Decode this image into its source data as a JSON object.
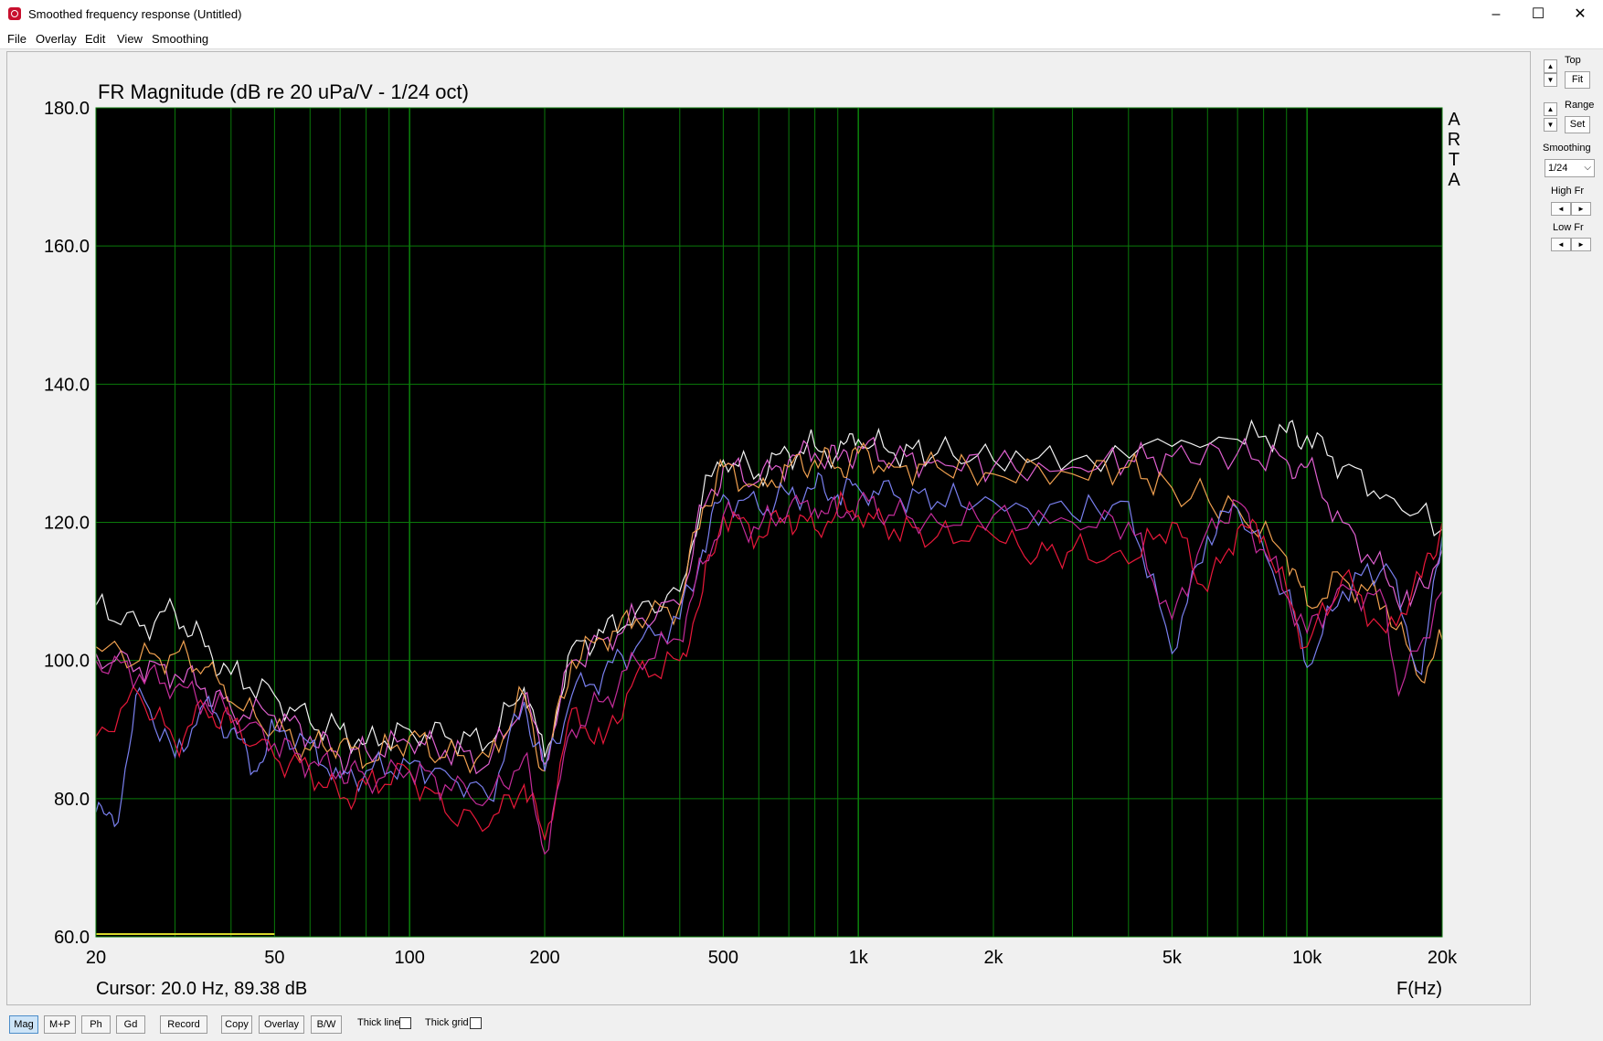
{
  "window": {
    "title": "Smoothed frequency response (Untitled)",
    "controls": [
      "–",
      "☐",
      "✕"
    ]
  },
  "menu": [
    "File",
    "Overlay",
    "Edit",
    "View",
    "Smoothing"
  ],
  "side_panel": {
    "top_label": "Top",
    "fit_label": "Fit",
    "range_label": "Range",
    "set_label": "Set",
    "smoothing_label": "Smoothing",
    "smoothing_value": "1/24",
    "high_fr_label": "High Fr",
    "low_fr_label": "Low Fr",
    "up_arrow": "▲",
    "down_arrow": "▼",
    "left_arrow": "◄",
    "right_arrow": "►",
    "caret": "⌵"
  },
  "bottom_bar": {
    "buttons": [
      "Mag",
      "M+P",
      "Ph",
      "Gd",
      "Record",
      "Copy",
      "Overlay",
      "B/W"
    ],
    "active": "Mag",
    "checkboxes": [
      "Thick line",
      "Thick grid"
    ]
  },
  "colors": {
    "plot_bg": "#000000",
    "grid": "#0a7a0a",
    "frame_bg": "#f0f0f0",
    "cursor": "#d8d82a",
    "series": [
      "#f2f2f2",
      "#e060d0",
      "#f0a050",
      "#7a80f0",
      "#e8183a",
      "#c42c9a"
    ]
  },
  "chart_data": {
    "type": "line",
    "title": "FR Magnitude (dB re 20 uPa/V - 1/24 oct)",
    "watermark": [
      "A",
      "R",
      "T",
      "A"
    ],
    "xlabel": "F(Hz)",
    "x_scale": "log",
    "xlim": [
      20,
      20000
    ],
    "ylim": [
      60,
      180
    ],
    "x_ticks": [
      20,
      50,
      100,
      200,
      500,
      1000,
      2000,
      5000,
      10000,
      20000
    ],
    "x_tick_labels": [
      "20",
      "50",
      "100",
      "200",
      "500",
      "1k",
      "2k",
      "5k",
      "10k",
      "20k"
    ],
    "y_ticks": [
      60,
      80,
      100,
      120,
      140,
      160,
      180
    ],
    "y_tick_labels": [
      "60.0",
      "80.0",
      "100.0",
      "120.0",
      "140.0",
      "160.0",
      "180.0"
    ],
    "grid": true,
    "cursor_text": "Cursor: 20.0 Hz, 89.38 dB",
    "cursor_marker": {
      "x": [
        20,
        50
      ],
      "y": 60.4
    },
    "series": [
      {
        "color": "#f2f2f2",
        "x": [
          20,
          25,
          30,
          35,
          40,
          50,
          60,
          70,
          80,
          100,
          120,
          150,
          180,
          200,
          230,
          270,
          320,
          400,
          450,
          500,
          600,
          700,
          800,
          900,
          1000,
          1200,
          1500,
          2000,
          3000,
          5000,
          7000,
          9000,
          10000,
          12000,
          15000,
          20000
        ],
        "y": [
          108,
          105,
          107,
          102,
          98,
          95,
          91,
          90,
          88,
          90,
          89,
          88,
          96,
          86,
          102,
          104,
          107,
          110,
          124,
          129,
          127,
          130,
          131,
          130,
          132,
          130,
          130,
          129,
          129,
          131,
          132,
          133,
          132.5,
          128,
          124,
          119
        ]
      },
      {
        "color": "#e060d0",
        "x": [
          20,
          25,
          30,
          35,
          40,
          50,
          60,
          70,
          80,
          100,
          120,
          150,
          180,
          200,
          230,
          270,
          320,
          400,
          450,
          500,
          600,
          700,
          800,
          900,
          1000,
          1200,
          1500,
          2000,
          3000,
          4000,
          5000,
          7000,
          9000,
          10000,
          12000,
          15000,
          17000,
          20000
        ],
        "y": [
          101,
          99,
          98,
          96,
          93,
          92,
          89,
          86,
          87,
          88,
          87,
          85,
          95,
          85,
          100,
          103,
          106,
          108,
          122,
          128,
          126,
          129,
          130,
          129,
          131,
          129,
          129,
          128,
          128,
          129,
          129.5,
          130,
          129,
          128,
          120,
          112,
          108,
          116
        ]
      },
      {
        "color": "#f0a050",
        "x": [
          20,
          25,
          30,
          35,
          40,
          50,
          60,
          70,
          80,
          100,
          120,
          150,
          180,
          200,
          230,
          270,
          320,
          400,
          450,
          500,
          600,
          700,
          800,
          900,
          1000,
          1200,
          1500,
          2000,
          3000,
          4000,
          5000,
          7000,
          9000,
          10000,
          12000,
          15000,
          18000,
          20000
        ],
        "y": [
          102,
          100,
          101,
          99,
          94,
          90,
          87,
          88,
          85,
          89,
          86,
          86,
          95,
          84,
          100,
          103,
          106,
          108,
          122,
          128,
          125,
          128,
          129,
          128,
          130,
          128,
          128,
          127,
          127,
          128,
          125,
          122,
          115,
          108,
          112,
          108,
          97,
          103
        ]
      },
      {
        "color": "#7a80f0",
        "x": [
          20,
          22,
          25,
          30,
          35,
          40,
          45,
          50,
          60,
          70,
          80,
          100,
          120,
          150,
          180,
          200,
          230,
          270,
          320,
          400,
          450,
          500,
          600,
          700,
          800,
          900,
          1000,
          1200,
          1500,
          2000,
          3000,
          4000,
          5000,
          6000,
          7000,
          9000,
          10000,
          12000,
          15000,
          18000,
          20000
        ],
        "y": [
          78,
          76,
          96,
          86,
          94,
          90,
          84,
          90,
          88,
          83,
          84,
          85,
          84,
          80,
          94,
          84,
          95,
          98,
          102,
          106,
          116,
          124,
          122,
          124,
          125,
          124,
          125,
          124,
          123,
          123,
          121,
          123,
          101,
          118,
          122,
          110,
          99,
          110,
          114,
          98,
          118
        ]
      },
      {
        "color": "#e8183a",
        "x": [
          20,
          25,
          30,
          35,
          40,
          50,
          60,
          70,
          80,
          100,
          120,
          150,
          180,
          200,
          230,
          270,
          320,
          400,
          450,
          500,
          600,
          700,
          800,
          900,
          1000,
          1200,
          1500,
          2000,
          2500,
          3000,
          4000,
          5000,
          6000,
          7000,
          8000,
          10000,
          12000,
          15000,
          18000,
          20000
        ],
        "y": [
          89,
          95,
          88,
          93,
          91,
          86,
          84,
          80,
          82,
          84,
          78,
          76,
          82,
          74,
          93,
          88,
          98,
          100,
          110,
          121,
          118,
          121,
          119,
          122,
          121,
          119,
          118,
          118,
          115,
          116,
          114,
          120,
          110,
          119,
          118,
          102,
          112,
          104,
          112,
          120
        ]
      },
      {
        "color": "#c42c9a",
        "x": [
          20,
          25,
          30,
          35,
          40,
          50,
          60,
          70,
          80,
          100,
          120,
          150,
          180,
          200,
          230,
          270,
          320,
          400,
          450,
          500,
          600,
          700,
          800,
          900,
          1000,
          1200,
          1500,
          2000,
          3000,
          4000,
          5000,
          6000,
          7000,
          8000,
          10000,
          12000,
          15000,
          16000,
          20000
        ],
        "y": [
          100,
          98,
          96,
          94,
          92,
          88,
          85,
          84,
          83,
          84,
          82,
          80,
          86,
          72,
          90,
          94,
          100,
          103,
          114,
          121,
          119,
          122,
          122,
          121,
          123,
          121,
          120,
          121,
          120,
          120,
          106,
          119,
          123,
          116,
          104,
          111,
          108,
          95,
          110
        ]
      }
    ]
  }
}
